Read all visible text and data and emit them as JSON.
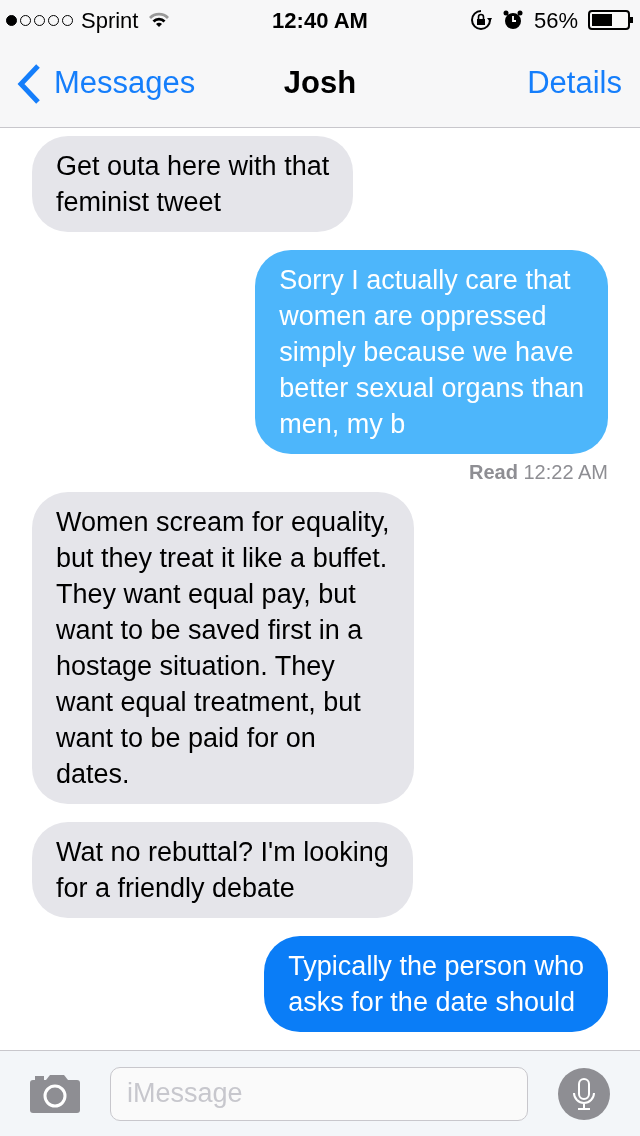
{
  "status_bar": {
    "signal": [
      {
        "filled": true
      },
      {
        "filled": false
      },
      {
        "filled": false
      },
      {
        "filled": false
      },
      {
        "filled": false
      }
    ],
    "carrier": "Sprint",
    "time": "12:40 AM",
    "battery": "56%"
  },
  "nav": {
    "back": "Messages",
    "title": "Josh",
    "action": "Details"
  },
  "messages": [
    {
      "kind": "incoming",
      "lines": [
        "Get outa here with that",
        "feminist tweet"
      ]
    },
    {
      "kind": "outgoing",
      "color": "#4db6fb",
      "lines": [
        "Sorry I actually care that",
        "women are oppressed",
        "simply because we have",
        "better sexual organs than",
        "men, my b"
      ],
      "receipt": {
        "label": "Read",
        "time": "12:22 AM"
      }
    },
    {
      "kind": "incoming",
      "lines": [
        "Women scream for equality,",
        "but they treat it like a buffet.",
        "They want equal pay, but",
        "want to be saved first in a",
        "hostage situation. They",
        "want equal treatment, but",
        "want to be paid for on",
        "dates."
      ]
    },
    {
      "kind": "incoming",
      "lines": [
        "Wat no rebuttal? I'm looking",
        "for a friendly debate"
      ]
    },
    {
      "kind": "outgoing",
      "color": "#0a7df7",
      "lines": [
        "Typically the person who",
        "asks for the date should"
      ]
    }
  ],
  "composer": {
    "placeholder": "iMessage"
  }
}
